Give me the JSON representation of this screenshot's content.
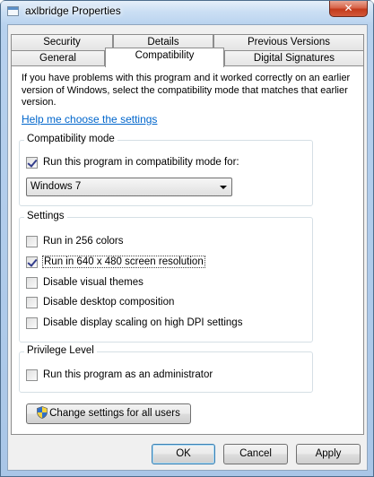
{
  "window": {
    "title": "axlbridge Properties",
    "close_glyph": "✕"
  },
  "tabs_row1": [
    {
      "label": "Security"
    },
    {
      "label": "Details"
    },
    {
      "label": "Previous Versions"
    }
  ],
  "tabs_row2": [
    {
      "label": "General"
    },
    {
      "label": "Compatibility",
      "active": true
    },
    {
      "label": "Digital Signatures"
    }
  ],
  "compat": {
    "intro": "If you have problems with this program and it worked correctly on an earlier version of Windows, select the compatibility mode that matches that earlier version.",
    "help_link": "Help me choose the settings",
    "mode_group": {
      "title": "Compatibility mode",
      "run_in_mode": {
        "label": "Run this program in compatibility mode for:",
        "checked": true
      },
      "selected_os": "Windows 7"
    },
    "settings_group": {
      "title": "Settings",
      "items": [
        {
          "label": "Run in 256 colors",
          "checked": false
        },
        {
          "label": "Run in 640 x 480 screen resolution",
          "checked": true
        },
        {
          "label": "Disable visual themes",
          "checked": false
        },
        {
          "label": "Disable desktop composition",
          "checked": false
        },
        {
          "label": "Disable display scaling on high DPI settings",
          "checked": false
        }
      ]
    },
    "privilege_group": {
      "title": "Privilege Level",
      "run_as_admin": {
        "label": "Run this program as an administrator",
        "checked": false
      }
    },
    "change_all_users": "Change settings for all users"
  },
  "footer": {
    "ok": "OK",
    "cancel": "Cancel",
    "apply": "Apply"
  },
  "colors": {
    "link": "#0066cc",
    "accent_border": "#3c7fb1",
    "close_red": "#c33b1c"
  }
}
